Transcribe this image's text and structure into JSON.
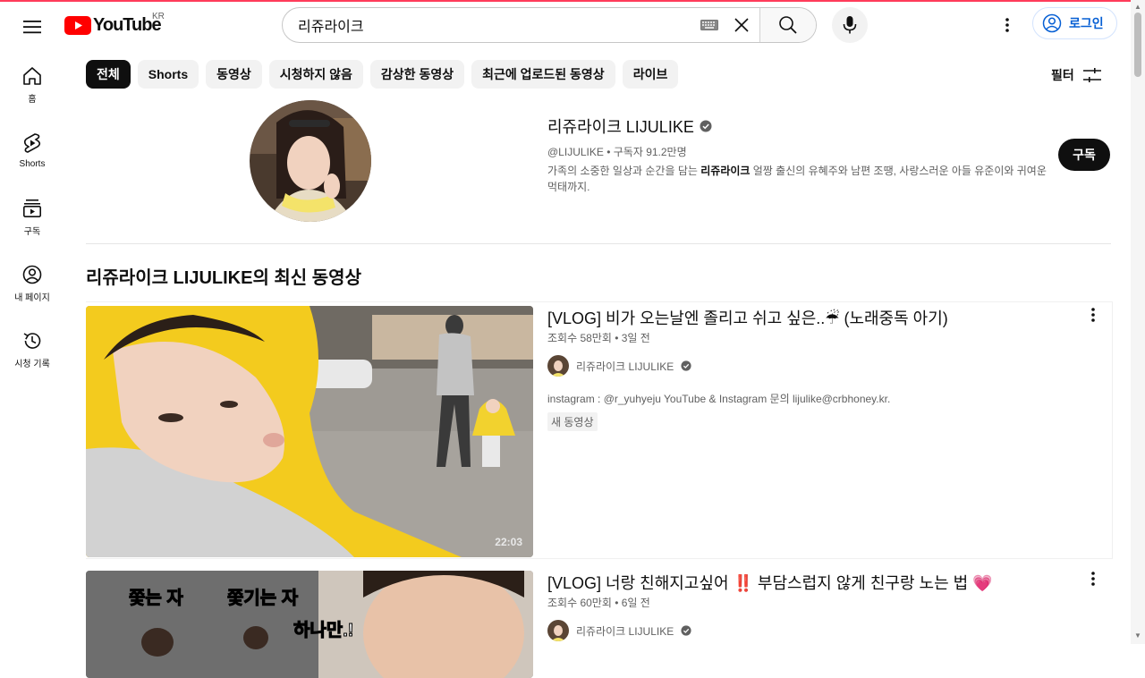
{
  "header": {
    "logo_text": "YouTube",
    "region": "KR",
    "search_value": "리쥬라이크",
    "login_label": "로그인"
  },
  "sidebar": {
    "items": [
      {
        "label": "홈",
        "icon": "home-icon"
      },
      {
        "label": "Shorts",
        "icon": "shorts-icon"
      },
      {
        "label": "구독",
        "icon": "subscriptions-icon"
      },
      {
        "label": "내 페이지",
        "icon": "you-icon"
      },
      {
        "label": "시청 기록",
        "icon": "history-icon"
      }
    ]
  },
  "chips": [
    "전체",
    "Shorts",
    "동영상",
    "시청하지 않음",
    "감상한 동영상",
    "최근에 업로드된 동영상",
    "라이브"
  ],
  "filter_label": "필터",
  "channel": {
    "name": "리쥬라이크 LIJULIKE",
    "handle_meta": "@LIJULIKE • 구독자 91.2만명",
    "desc_before": "가족의 소중한 일상과 순간을 담는 ",
    "desc_bold": "리쥬라이크",
    "desc_after": " 얼짱 출신의 유혜주와 남편 조땡, 사랑스러운 아들 유준이와 귀여운 먹태까지.",
    "subscribe_label": "구독"
  },
  "section_title": "리쥬라이크 LIJULIKE의 최신 동영상",
  "videos": [
    {
      "title": "[VLOG] 비가 오는날엔 졸리고 쉬고 싶은..☔  (노래중독 아기)",
      "stats": "조회수 58만회 • 3일 전",
      "channel": "리쥬라이크 LIJULIKE",
      "description": "instagram : @r_yuhyeju YouTube & Instagram 문의 lijulike@crbhoney.kr.",
      "badge": "새 동영상",
      "duration": "22:03"
    },
    {
      "title": "[VLOG] 너랑 친해지고싶어 ‼️  부담스럽지 않게 친구랑 노는 법 💗",
      "stats": "조회수 60만회 • 6일 전",
      "channel": "리쥬라이크 LIJULIKE",
      "thumb_text_1": "쫓는 자",
      "thumb_text_2": "쫓기는 자",
      "thumb_text_3": "하나만.!"
    }
  ]
}
